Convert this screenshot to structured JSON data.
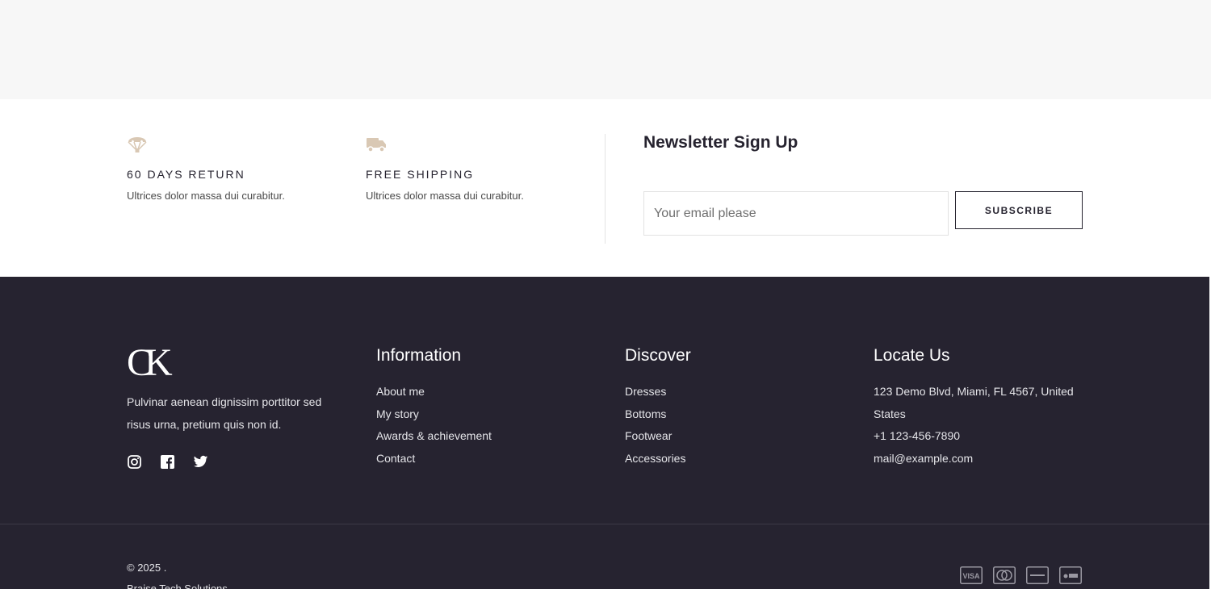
{
  "features": [
    {
      "icon": "parachute-icon",
      "title": "60 DAYS RETURN",
      "desc": "Ultrices dolor massa dui curabitur."
    },
    {
      "icon": "truck-icon",
      "title": "FREE SHIPPING",
      "desc": "Ultrices dolor massa dui curabitur."
    }
  ],
  "newsletter": {
    "title": "Newsletter Sign Up",
    "placeholder": "Your email please",
    "button": "SUBSCRIBE"
  },
  "footer": {
    "logo_text": "CK",
    "about": "Pulvinar aenean dignissim porttitor sed risus urna, pretium quis non id.",
    "socials": [
      "instagram-icon",
      "facebook-icon",
      "twitter-icon"
    ],
    "information": {
      "title": "Information",
      "links": [
        "About me",
        "My story",
        "Awards & achievement",
        "Contact"
      ]
    },
    "discover": {
      "title": "Discover",
      "links": [
        "Dresses",
        "Bottoms",
        "Footwear",
        "Accessories"
      ]
    },
    "locate": {
      "title": "Locate Us",
      "address": "123 Demo Blvd, Miami, FL 4567, United States",
      "phone": "+1 123-456-7890",
      "email": "mail@example.com"
    },
    "copyright_line1": "© 2025 .",
    "copyright_line2": "Braise Tech Solutions",
    "payments": [
      "visa-icon",
      "mastercard-icon",
      "discover-icon",
      "apple-pay-icon"
    ]
  },
  "colors": {
    "accent": "#d9c8b4",
    "footer_bg": "#262330",
    "dark_text": "#26232f"
  }
}
